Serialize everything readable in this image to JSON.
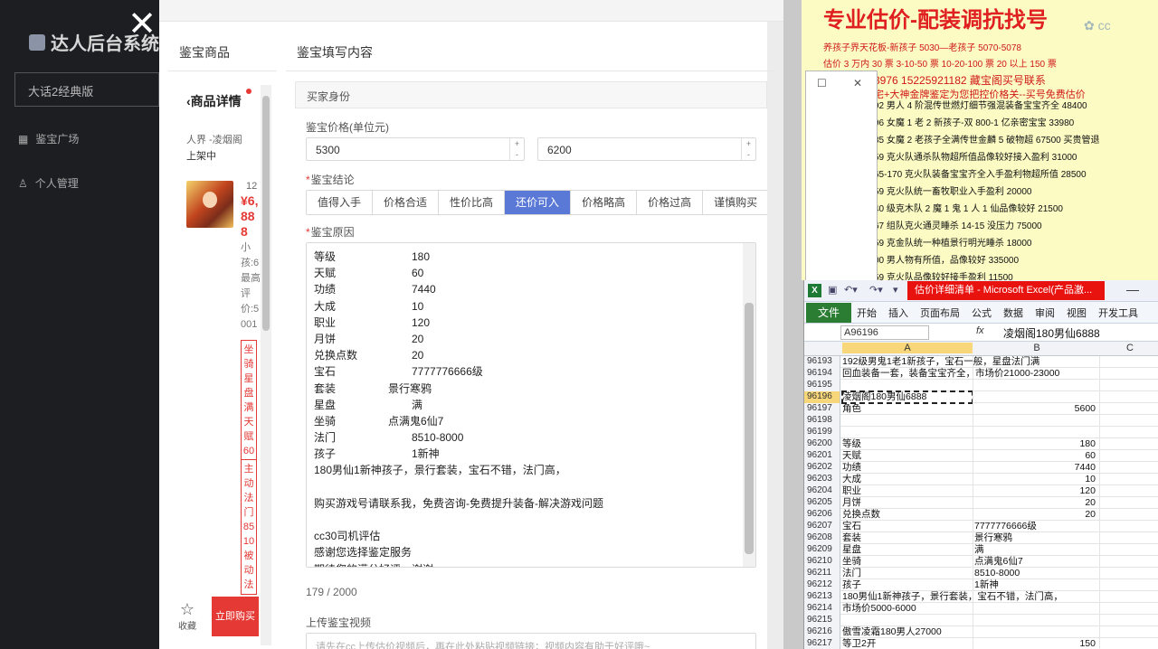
{
  "sidebar": {
    "title": "达人后台系统",
    "server_select": "大话2经典版",
    "nav": [
      {
        "label": "鉴宝广场"
      },
      {
        "label": "个人管理"
      }
    ]
  },
  "modal": {
    "left_title": "鉴宝商品",
    "right_title": "鉴宝填写内容"
  },
  "product": {
    "detail_title": "商品详情",
    "world": "人界 -凌烟阁",
    "status": "上架中",
    "num": "12",
    "price": "¥6,888",
    "desc": "小孩:6最高评价:5001",
    "tag1": "坐骑星盘满天赋60",
    "tag2": "主动法门8510被动法",
    "fav": "收藏",
    "buy": "立即购买"
  },
  "form": {
    "section_title": "买家身份",
    "price_label": "鉴宝价格(单位元)",
    "price_low": "5300",
    "price_high": "6200",
    "conclusion_label": "鉴宝结论",
    "conclusions": [
      "值得入手",
      "价格合适",
      "性价比高",
      "还价可入",
      "价格略高",
      "价格过高",
      "谨慎购买"
    ],
    "active_conclusion": "还价可入",
    "reason_label": "鉴宝原因",
    "reason_kv": [
      {
        "k": "等级",
        "v": "180"
      },
      {
        "k": "天赋",
        "v": "60"
      },
      {
        "k": "功绩",
        "v": "7440"
      },
      {
        "k": "大成",
        "v": "10"
      },
      {
        "k": "职业",
        "v": "120"
      },
      {
        "k": "月饼",
        "v": "20"
      },
      {
        "k": "兑换点数",
        "v": "20"
      },
      {
        "k": "宝石",
        "v": "7777776666级"
      },
      {
        "k": "套装",
        "v": "景行寒鸦"
      },
      {
        "k": "星盘",
        "v": "满"
      },
      {
        "k": "坐骑",
        "v": "点满鬼6仙7"
      },
      {
        "k": "法门",
        "v": "8510-8000"
      },
      {
        "k": "孩子",
        "v": "1新神"
      }
    ],
    "reason_lines": [
      "180男仙1新神孩子，景行套装，宝石不错，法门高，",
      "",
      "购买游戏号请联系我，免费咨询-免费提升装备-解决游戏问题",
      "",
      "cc30司机评估",
      "感谢您选择鉴定服务",
      "期待您的满分好评，谢谢"
    ],
    "counter": "179 / 2000",
    "video_label": "上传鉴宝视频",
    "video_placeholder": "请先在cc上传估价视频后，再在此处粘贴视频链接；视频内容有助于好评哦~"
  },
  "yellow_doc": {
    "headline": "专业估价-配装调抗找号",
    "line1": "养孩子界天花板-新孩子 5030—老孩子 5070-5078",
    "line2": "估价 3 万内 30 票    3-10-50 票    10-20-100 票    20 以上 150 票",
    "line3": "3976    15225921182    藏宝阁买号联系",
    "line4": "宅+大神金牌鉴定为您把控价格关--买号免费估价",
    "list": [
      "92 男人 4 阶混传世燃灯细节强混装备宝宝齐全 48400",
      "96 女魔 1 老 2 新孩子-双 800-1 亿亲密宝宝 33980",
      "85 女魔 2 老孩子全满传世金麟 5 破物超 67500 买贵管退",
      "59 克火队通杀队物超所值品像较好接入盈利 31000",
      "65-170 克火队装备宝宝齐全入手盈利物超所值 28500",
      "59 克火队统一畜牧职业入手盈利 20000",
      "40 级克木队 2 魔 1 鬼 1 人 1 仙品像较好 21500",
      "67 组队克火通灵睡杀 14-15 没压力 75000",
      "59 克金队统一种植景行明光睡杀 18000",
      "00 男人物有所值，品像较好 335000",
      "59 克火队品像较好接手盈利 11500"
    ]
  },
  "excel": {
    "title": "估价详细清单 - Microsoft Excel(产品激...",
    "tabs": [
      "开始",
      "插入",
      "页面布局",
      "公式",
      "数据",
      "审阅",
      "视图",
      "开发工具"
    ],
    "file_tab": "文件",
    "name_box": "A96196",
    "fx": "fx",
    "formula": "凌烟阁180男仙6888",
    "columns": [
      "A",
      "B",
      "C"
    ],
    "rows": [
      {
        "n": "96193",
        "a": "192级男鬼1老1新孩子，宝石一般，星盘法门满",
        "b": ""
      },
      {
        "n": "96194",
        "a": "回血装备一套，装备宝宝齐全，市场价21000-23000",
        "b": ""
      },
      {
        "n": "96195",
        "a": "",
        "b": ""
      },
      {
        "n": "96196",
        "a": "凌烟阁180男仙6888",
        "b": ""
      },
      {
        "n": "96197",
        "a": "角色",
        "b": "5600"
      },
      {
        "n": "96198",
        "a": "",
        "b": ""
      },
      {
        "n": "96199",
        "a": "",
        "b": ""
      },
      {
        "n": "96200",
        "a": "等级",
        "b": "180"
      },
      {
        "n": "96201",
        "a": "天赋",
        "b": "60"
      },
      {
        "n": "96202",
        "a": "功绩",
        "b": "7440"
      },
      {
        "n": "96203",
        "a": "大成",
        "b": "10"
      },
      {
        "n": "96204",
        "a": "职业",
        "b": "120"
      },
      {
        "n": "96205",
        "a": "月饼",
        "b": "20"
      },
      {
        "n": "96206",
        "a": "兑换点数",
        "b": "20"
      },
      {
        "n": "96207",
        "a": "宝石",
        "b": "7777776666级"
      },
      {
        "n": "96208",
        "a": "套装",
        "b": "景行寒鸦"
      },
      {
        "n": "96209",
        "a": "星盘",
        "b": "满"
      },
      {
        "n": "96210",
        "a": "坐骑",
        "b": "点满鬼6仙7"
      },
      {
        "n": "96211",
        "a": "法门",
        "b": "8510-8000"
      },
      {
        "n": "96212",
        "a": "孩子",
        "b": "1新神"
      },
      {
        "n": "96213",
        "a": "180男仙1新神孩子，景行套装，宝石不错，法门高，",
        "b": ""
      },
      {
        "n": "96214",
        "a": "市场价5000-6000",
        "b": ""
      },
      {
        "n": "96215",
        "a": "",
        "b": ""
      },
      {
        "n": "96216",
        "a": "傲雪凌霜180男人27000",
        "b": ""
      },
      {
        "n": "96217",
        "a": "等卫2开",
        "b": "150"
      }
    ]
  }
}
